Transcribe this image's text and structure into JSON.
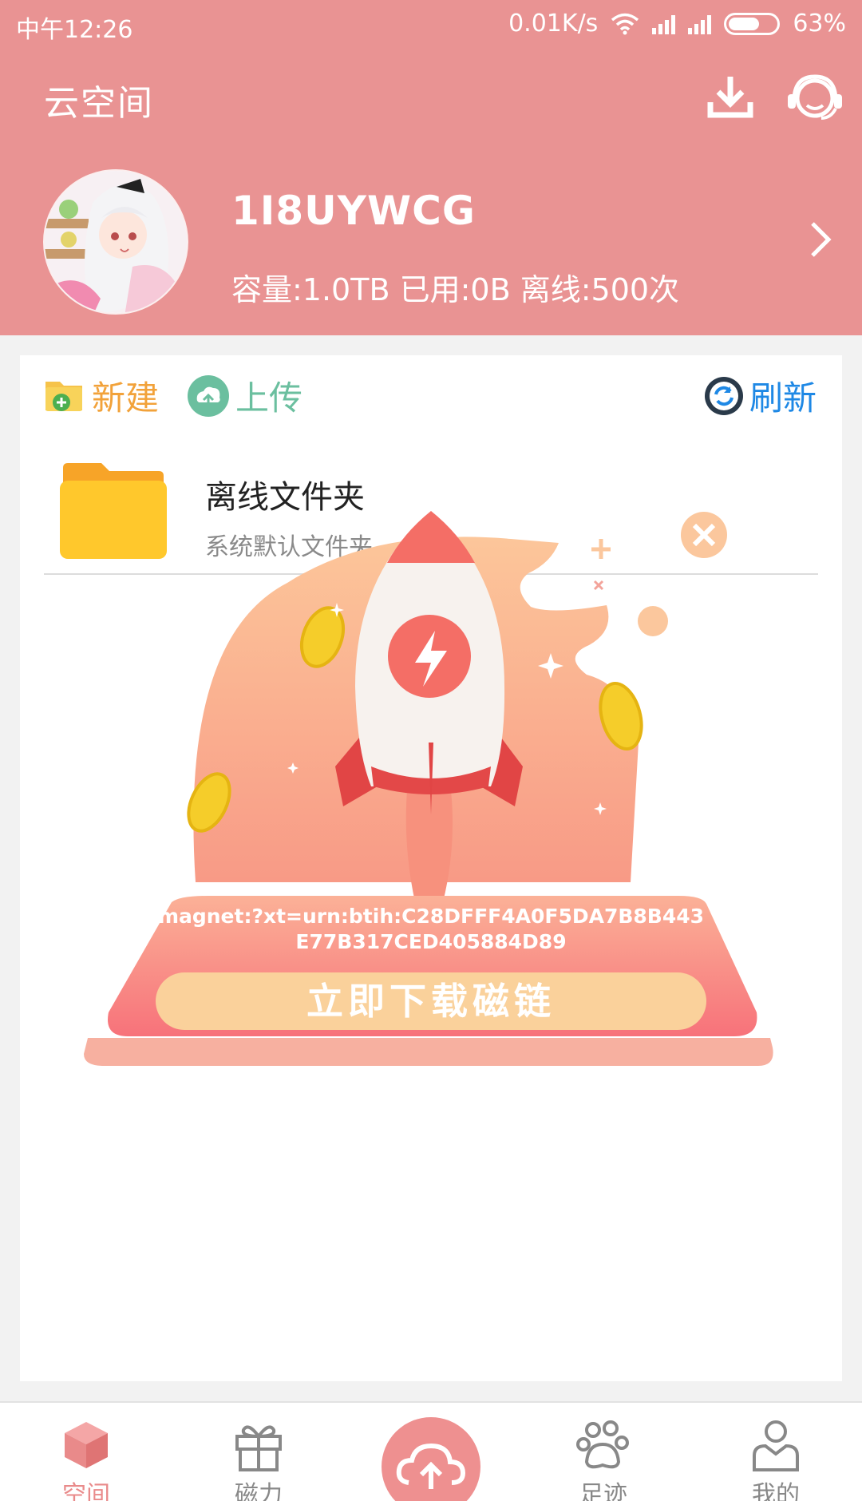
{
  "status_bar": {
    "time": "中午12:26",
    "speed": "0.01K/s",
    "battery": "63%"
  },
  "header": {
    "title": "云空间",
    "username": "1I8UYWCG",
    "usage": "容量:1.0TB 已用:0B 离线:500次"
  },
  "toolbar": {
    "new_label": "新建",
    "upload_label": "上传",
    "refresh_label": "刷新"
  },
  "files": [
    {
      "name": "离线文件夹",
      "desc": "系统默认文件夹"
    }
  ],
  "promo": {
    "magnet": "magnet:?xt=urn:btih:C28DFFF4A0F5DA7B8B443E77B317CED405884D89",
    "cta_label": "立即下载磁链"
  },
  "bottom_nav": [
    {
      "label": "空间",
      "active": true
    },
    {
      "label": "磁力",
      "active": false
    },
    {
      "label": "",
      "active": false
    },
    {
      "label": "足迹",
      "active": false
    },
    {
      "label": "我的",
      "active": false
    }
  ],
  "colors": {
    "brand": "#e99393",
    "accent_orange": "#f2a23a",
    "accent_green": "#6bbf9f",
    "accent_blue": "#1e88e5"
  }
}
